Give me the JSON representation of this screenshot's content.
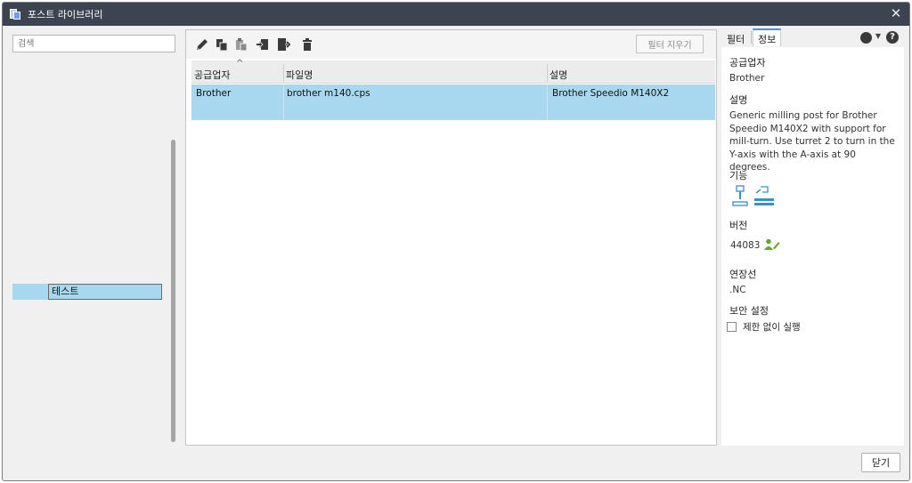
{
  "window": {
    "title": "포스트 라이브러리"
  },
  "left": {
    "search_placeholder": "검색",
    "tree_item_label": "테스트"
  },
  "toolbar": {
    "icons": [
      "pencil-icon",
      "copy-icon",
      "paste-icon",
      "import-icon",
      "export-icon",
      "trash-icon"
    ],
    "filter_clear_label": "필터 지우기"
  },
  "table": {
    "columns": [
      "공급업자",
      "파일명",
      "설명"
    ],
    "rows": [
      {
        "vendor": "Brother",
        "filename": "brother m140.cps",
        "description": "Brother Speedio M140X2"
      }
    ]
  },
  "right": {
    "tabs": [
      "필터",
      "정보"
    ],
    "active_tab": "정보",
    "vendor_label": "공급업자",
    "vendor_value": "Brother",
    "description_label": "설명",
    "description_value": "Generic milling post for Brother Speedio M140X2 with support for mill-turn.  Use turret 2 to turn in the Y-axis with the A-axis at 90 degrees.",
    "capability_label": "기능",
    "version_label": "버전",
    "version_value": "44083",
    "extension_label": "연장선",
    "extension_value": ".NC",
    "security_label": "보안 설정",
    "run_unrestricted_label": "제한 없이 실행",
    "run_unrestricted_checked": false
  },
  "footer": {
    "close_label": "닫기"
  },
  "colors": {
    "selection": "#a8d8ef",
    "titlebar": "#3c4451",
    "accent": "#3a8fc9",
    "version_icon": "#6aa62c"
  }
}
